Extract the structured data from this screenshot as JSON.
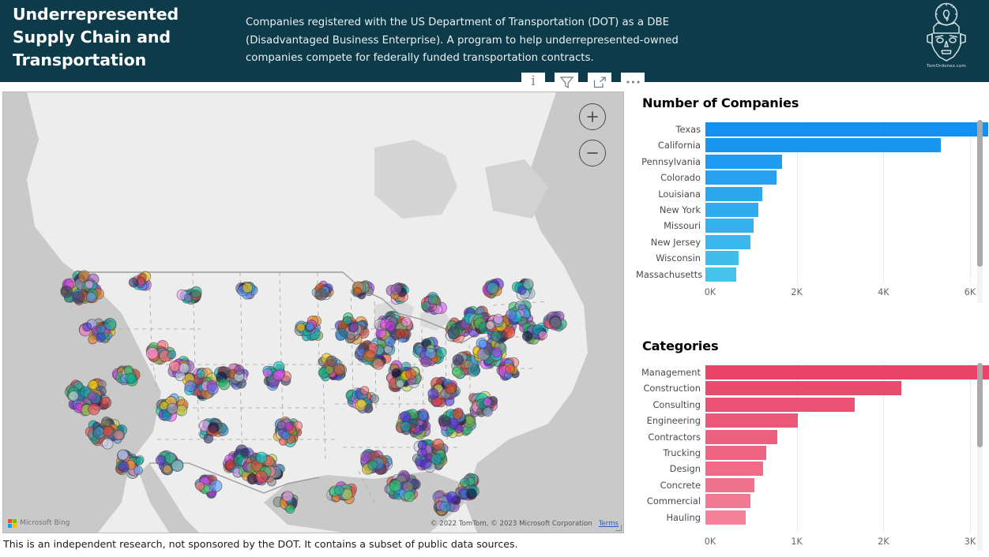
{
  "header": {
    "title": "Underrepresented Supply Chain and Transportation",
    "description": "Companies registered with the US Department of Transportation (DOT) as a DBE (Disadvantaged Business Enterprise). A program to help underrepresented-owned companies compete for federally funded transportation contracts.",
    "background_color": "#0D3B4A",
    "logo_caption": "TomOrdonez.com"
  },
  "toolbar": {
    "info_label": "i",
    "items": [
      {
        "name": "info-icon",
        "tooltip": "i"
      },
      {
        "name": "filter-icon",
        "tooltip": "Filters"
      },
      {
        "name": "focus-mode-icon",
        "tooltip": "Focus mode"
      },
      {
        "name": "more-options-icon",
        "tooltip": "More options"
      }
    ]
  },
  "map": {
    "zoom_in_label": "+",
    "zoom_out_label": "−",
    "provider_logo_text": "Microsoft Bing",
    "attribution": "© 2022 TomTom, © 2023 Microsoft Corporation",
    "terms_label": "Terms",
    "land_color": "#EDEDED",
    "water_color": "#C9C9C9",
    "border_color": "#b0b0b0"
  },
  "footer": {
    "note": "This is an independent research, not sponsored by the DOT. It contains a subset of public data sources."
  },
  "chart_data": [
    {
      "type": "bar",
      "id": "number-of-companies",
      "title": "Number of Companies",
      "orientation": "horizontal",
      "xlabel": "",
      "ylabel": "",
      "xlim": [
        0,
        6000
      ],
      "grid": true,
      "legend": "none",
      "tick_labels": [
        "0K",
        "2K",
        "4K",
        "6K"
      ],
      "tick_values": [
        0,
        2000,
        4000,
        6000
      ],
      "bar_color_start": "#1590F0",
      "bar_color_end": "#45C3EA",
      "categories": [
        "Texas",
        "California",
        "Pennsylvania",
        "Colorado",
        "Louisiana",
        "New York",
        "Missouri",
        "New Jersey",
        "Wisconsin",
        "Massachusetts"
      ],
      "values": [
        5980,
        4980,
        1620,
        1510,
        1210,
        1120,
        1020,
        950,
        710,
        650
      ],
      "scroll": {
        "thumb_top_pct": 0,
        "thumb_height_pct": 80
      }
    },
    {
      "type": "bar",
      "id": "categories",
      "title": "Categories",
      "orientation": "horizontal",
      "xlabel": "",
      "ylabel": "",
      "xlim": [
        0,
        3000
      ],
      "grid": true,
      "legend": "none",
      "tick_labels": [
        "0K",
        "1K",
        "2K",
        "3K"
      ],
      "tick_values": [
        0,
        1000,
        2000,
        3000
      ],
      "bar_color_start": "#E8446A",
      "bar_color_end": "#F28098",
      "categories": [
        "Management",
        "Construction",
        "Consulting",
        "Engineering",
        "Contractors",
        "Trucking",
        "Design",
        "Concrete",
        "Commercial",
        "Hauling"
      ],
      "values": [
        3090,
        2070,
        1580,
        980,
        760,
        640,
        610,
        520,
        480,
        430
      ],
      "scroll": {
        "thumb_top_pct": 0,
        "thumb_height_pct": 45
      }
    }
  ]
}
